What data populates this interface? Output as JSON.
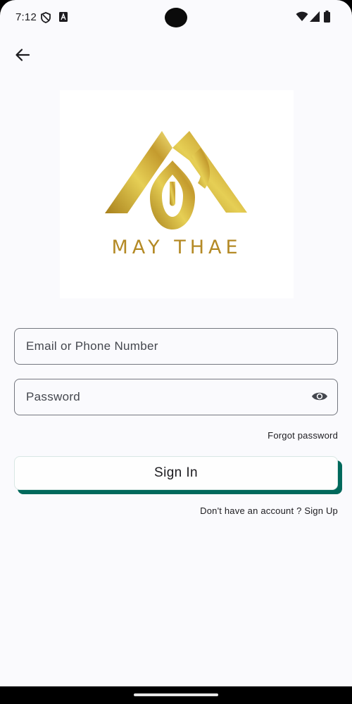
{
  "status_bar": {
    "time": "7:12",
    "left_icons": [
      "shield-icon",
      "font-icon"
    ],
    "right_icons": [
      "wifi-icon",
      "signal-icon",
      "battery-icon"
    ]
  },
  "header": {
    "back_icon": "arrow-back-icon"
  },
  "logo": {
    "brand_text": "MAY THAE",
    "gold": "#c9a22e"
  },
  "form": {
    "email_placeholder": "Email or Phone Number",
    "email_value": "",
    "password_placeholder": "Password",
    "password_value": "",
    "password_toggle_icon": "eye-icon",
    "forgot_label": "Forgot password",
    "signin_label": "Sign In",
    "signup_label": "Don't have an account ? Sign Up"
  },
  "colors": {
    "accent": "#00695c",
    "background": "#fafafd"
  }
}
